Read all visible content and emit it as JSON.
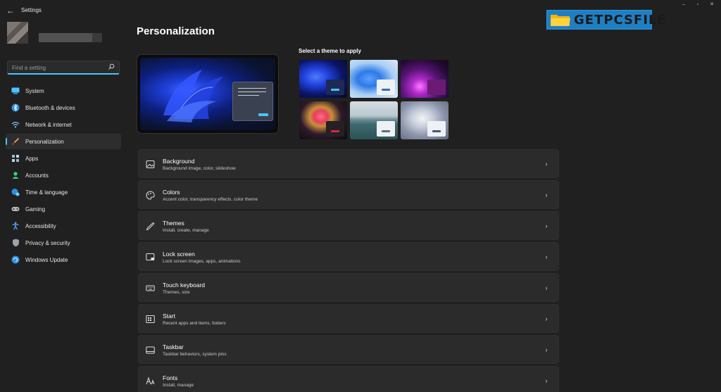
{
  "window": {
    "back_glyph": "←",
    "title": "Settings",
    "controls": [
      "–",
      "▫",
      "✕"
    ]
  },
  "search": {
    "placeholder": "Find a setting"
  },
  "sidebar": {
    "items": [
      {
        "label": "System",
        "icon": "display-icon"
      },
      {
        "label": "Bluetooth & devices",
        "icon": "bluetooth-icon"
      },
      {
        "label": "Network & internet",
        "icon": "wifi-icon"
      },
      {
        "label": "Personalization",
        "icon": "brush-icon",
        "selected": true
      },
      {
        "label": "Apps",
        "icon": "apps-icon"
      },
      {
        "label": "Accounts",
        "icon": "person-icon"
      },
      {
        "label": "Time & language",
        "icon": "globe-clock-icon"
      },
      {
        "label": "Gaming",
        "icon": "gamepad-icon"
      },
      {
        "label": "Accessibility",
        "icon": "accessibility-icon"
      },
      {
        "label": "Privacy & security",
        "icon": "shield-icon"
      },
      {
        "label": "Windows Update",
        "icon": "update-icon"
      }
    ]
  },
  "main": {
    "title": "Personalization",
    "logo_text": "GETPCSFILE",
    "themes_label": "Select a theme to apply",
    "theme_count": 6,
    "rows": [
      {
        "title": "Background",
        "subtitle": "Background image, color, slideshow",
        "icon": "image-icon"
      },
      {
        "title": "Colors",
        "subtitle": "Accent color, transparency effects, color theme",
        "icon": "palette-icon"
      },
      {
        "title": "Themes",
        "subtitle": "Install, create, manage",
        "icon": "pen-icon"
      },
      {
        "title": "Lock screen",
        "subtitle": "Lock screen images, apps, animations",
        "icon": "lock-screen-icon"
      },
      {
        "title": "Touch keyboard",
        "subtitle": "Themes, size",
        "icon": "keyboard-icon"
      },
      {
        "title": "Start",
        "subtitle": "Recent apps and items, folders",
        "icon": "start-icon"
      },
      {
        "title": "Taskbar",
        "subtitle": "Taskbar behaviors, system pins",
        "icon": "taskbar-icon"
      },
      {
        "title": "Fonts",
        "subtitle": "Install, manage",
        "icon": "fonts-icon"
      }
    ],
    "chevron": "›"
  },
  "colors": {
    "accent": "#4cc2ff",
    "background": "#202020",
    "card": "#2b2b2b"
  }
}
